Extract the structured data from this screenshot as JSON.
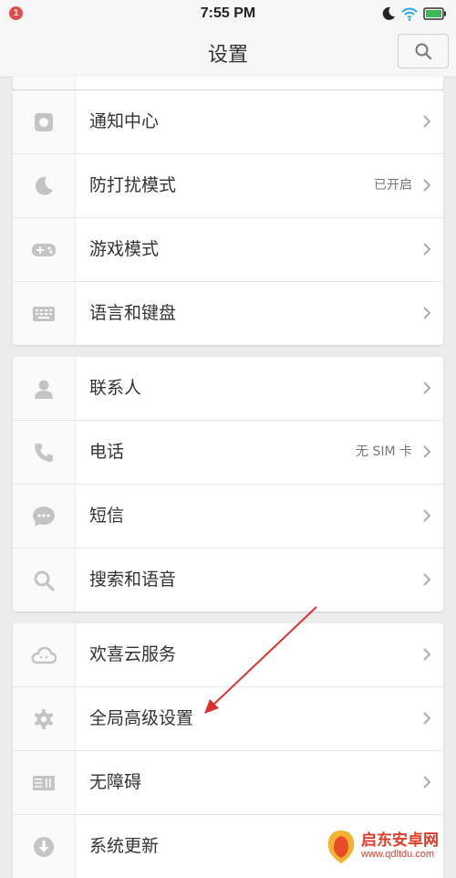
{
  "status_bar": {
    "notification_count": "1",
    "time": "7:55 PM"
  },
  "header": {
    "title": "设置"
  },
  "groups": [
    {
      "items": [
        {
          "label": "通知中心",
          "value": "",
          "icon": "notification-center-icon"
        },
        {
          "label": "防打扰模式",
          "value": "已开启",
          "icon": "moon-icon"
        },
        {
          "label": "游戏模式",
          "value": "",
          "icon": "gamepad-icon"
        },
        {
          "label": "语言和键盘",
          "value": "",
          "icon": "keyboard-icon"
        }
      ]
    },
    {
      "items": [
        {
          "label": "联系人",
          "value": "",
          "icon": "person-icon"
        },
        {
          "label": "电话",
          "value": "无 SIM 卡",
          "icon": "phone-icon"
        },
        {
          "label": "短信",
          "value": "",
          "icon": "message-icon"
        },
        {
          "label": "搜索和语音",
          "value": "",
          "icon": "search-icon"
        }
      ]
    },
    {
      "items": [
        {
          "label": "欢喜云服务",
          "value": "",
          "icon": "cloud-icon"
        },
        {
          "label": "全局高级设置",
          "value": "",
          "icon": "gear-icon"
        },
        {
          "label": "无障碍",
          "value": "",
          "icon": "accessibility-icon"
        },
        {
          "label": "系统更新",
          "value": "",
          "icon": "download-icon"
        }
      ]
    }
  ],
  "watermark": {
    "title": "启东安卓网",
    "url": "www.qdltdu.com"
  },
  "colors": {
    "background": "#ececec",
    "card": "#ffffff",
    "icon_gray": "#c4c4c4",
    "annotation_arrow": "#d9342b"
  }
}
